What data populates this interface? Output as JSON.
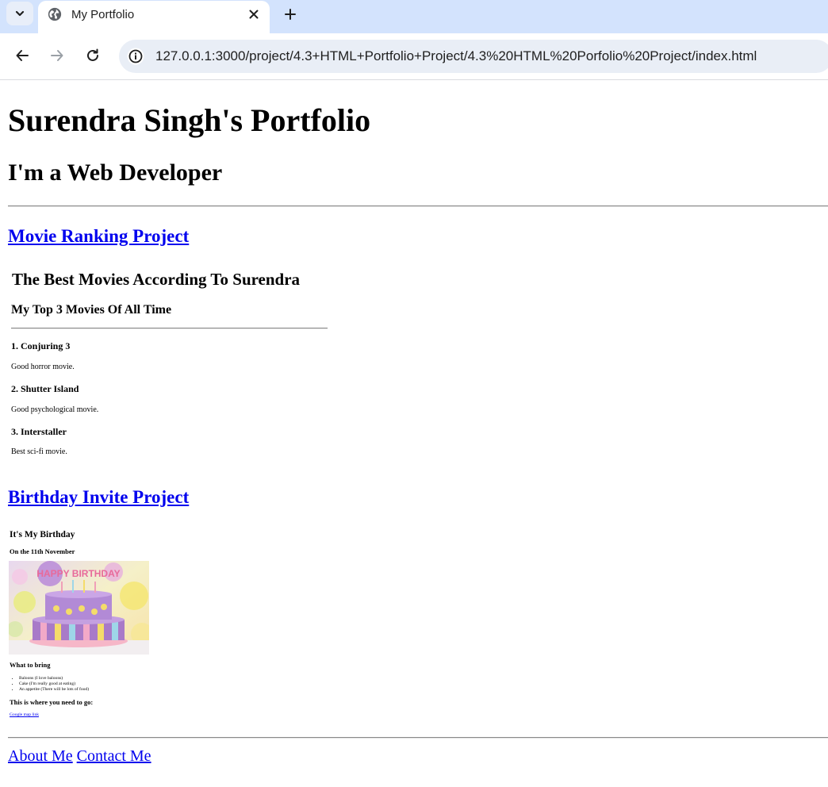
{
  "browser": {
    "tab_title": "My Portfolio",
    "url": "127.0.0.1:3000/project/4.3+HTML+Portfolio+Project/4.3%20HTML%20Porfolio%20Project/index.html"
  },
  "page": {
    "title": "Surendra Singh's Portfolio",
    "subtitle": "I'm a Web Developer",
    "projects": [
      {
        "link_text": "Movie Ranking Project"
      },
      {
        "link_text": "Birthday Invite Project"
      }
    ],
    "movie_frame": {
      "heading": "The Best Movies According To Surendra",
      "subheading": "My Top 3 Movies Of All Time",
      "movies": [
        {
          "title": "1. Conjuring 3",
          "description": "Good horror movie."
        },
        {
          "title": "2. Shutter Island",
          "description": "Good psychological movie."
        },
        {
          "title": "3. Interstaller",
          "description": "Best sci-fi movie."
        }
      ]
    },
    "birthday_frame": {
      "heading": "It's My Birthday",
      "date": "On the 11th November",
      "cake_text": "HAPPY BIRTHDAY",
      "bring_heading": "What to bring",
      "items": [
        "Baloons (I love baloons)",
        "Cake (I'm really good at eating)",
        "An appetite (There will be lots of food)"
      ],
      "location_heading": "This is where you need to go:",
      "map_link": "Google map link"
    },
    "footer": {
      "about": "About Me",
      "contact": "Contact Me"
    }
  }
}
